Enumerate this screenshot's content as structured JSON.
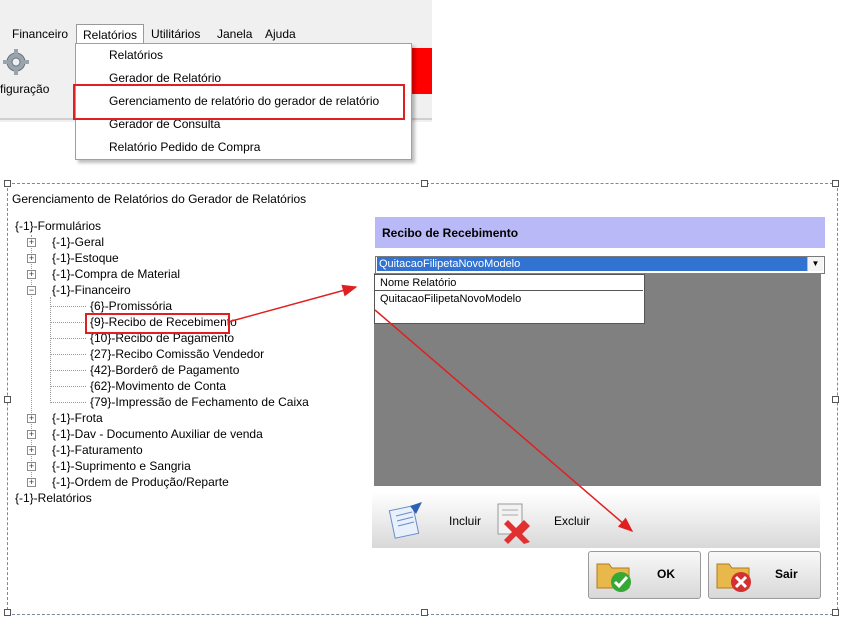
{
  "menubar": {
    "items": [
      "Financeiro",
      "Relatórios",
      "Utilitários",
      "Janela",
      "Ajuda"
    ]
  },
  "toolbar": {
    "config_label": "figuração"
  },
  "dropdown": {
    "items": [
      "Relatórios",
      "Gerador de Relatório",
      "Gerenciamento de relatório do gerador de relatório",
      "Gerador de Consulta",
      "Relatório Pedido de Compra"
    ]
  },
  "window": {
    "title": "Gerenciamento de Relatórios do Gerador de Relatórios",
    "tree": {
      "root": "{-1}-Formulários",
      "nodes": [
        "{-1}-Geral",
        "{-1}-Estoque",
        "{-1}-Compra de Material",
        "{-1}-Financeiro",
        "{6}-Promissória",
        "{9}-Recibo de Recebimento",
        "{10}-Recibo de Pagamento",
        "{27}-Recibo Comissão Vendedor",
        "{42}-Borderô de Pagamento",
        "{62}-Movimento de Conta",
        "{79}-Impressão de Fechamento de Caixa",
        "{-1}-Frota",
        "{-1}-Dav - Documento Auxiliar de venda",
        "{-1}-Faturamento",
        "{-1}-Suprimento e Sangria",
        "{-1}-Ordem de Produção/Reparte"
      ],
      "root2": "{-1}-Relatórios"
    },
    "panel": {
      "title": "Recibo de Recebimento",
      "combo_value": "QuitacaoFilipetaNovoModelo",
      "grid_header": "Nome Relatório",
      "grid_rows": [
        "QuitacaoFilipetaNovoModelo"
      ]
    },
    "actions": {
      "include": "Incluir",
      "exclude": "Excluir"
    },
    "buttons": {
      "ok": "OK",
      "exit": "Sair"
    }
  },
  "colors": {
    "highlight": "#e02020",
    "panel_header": "#b9b9f7",
    "combo_selected": "#3272d0",
    "toolbar_red": "#ff0000"
  }
}
